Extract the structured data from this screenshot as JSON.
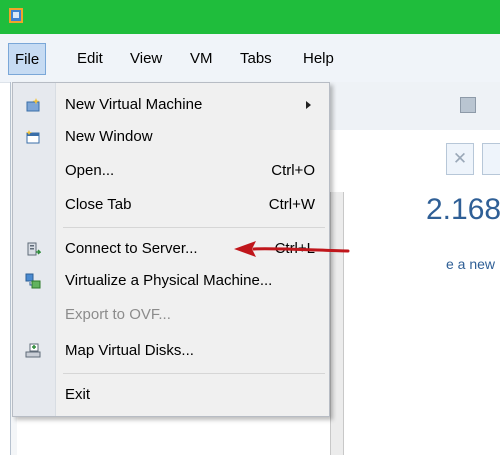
{
  "menubar": {
    "items": [
      "File",
      "Edit",
      "View",
      "VM",
      "Tabs",
      "Help"
    ]
  },
  "background": {
    "ip_fragment": "2.168",
    "link_fragment": "e a new"
  },
  "file_menu": {
    "items": [
      {
        "label": "New Virtual Machine",
        "shortcut": "",
        "submenu": true,
        "icon": "new-vm-icon"
      },
      {
        "label": "New Window",
        "shortcut": "",
        "icon": "new-window-icon"
      },
      {
        "label": "Open...",
        "shortcut": "Ctrl+O"
      },
      {
        "label": "Close Tab",
        "shortcut": "Ctrl+W"
      },
      {
        "label": "Connect to Server...",
        "shortcut": "Ctrl+L",
        "icon": "connect-server-icon"
      },
      {
        "label": "Virtualize a Physical Machine...",
        "shortcut": "",
        "icon": "virtualize-icon"
      },
      {
        "label": "Export to OVF...",
        "shortcut": "",
        "disabled": true
      },
      {
        "label": "Map Virtual Disks...",
        "shortcut": "",
        "icon": "map-disks-icon"
      },
      {
        "label": "Exit",
        "shortcut": ""
      }
    ]
  },
  "colors": {
    "titlebar": "#1fbd3c",
    "annotation_arrow": "#c0161b"
  }
}
